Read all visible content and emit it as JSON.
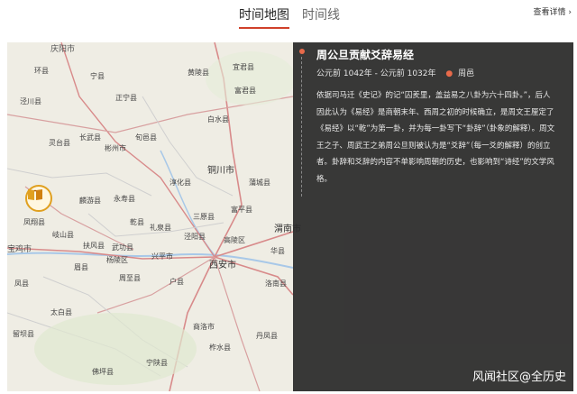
{
  "tabs": [
    {
      "label": "时间地图",
      "active": true
    },
    {
      "label": "时间线",
      "active": false
    }
  ],
  "detail_link": "查看详情 ›",
  "event": {
    "title": "周公旦贡献爻辞易经",
    "date_range": "公元前 1042年 - 公元前 1032年",
    "location": "周邑",
    "description": "依据司马迁《史记》的记“囚羑里，盖益易之八卦为六十四卦。”，后人因此认为《易经》是商朝末年、西周之初的时候确立，是周文王厘定了《易经》以“乾”为第一卦，并为每一卦写下“卦辞”（卦象的解释）。周文王之子、周武王之弟周公旦则被认为是“爻辞”（每一爻的解释）的创立者。卦辞和爻辞的内容不单影响周朝的历史，也影响到“诗经”的文学风格。"
  },
  "watermark": "风闻社区@全历史",
  "map_labels": {
    "l0": "庆阳市",
    "l1": "环县",
    "l2": "宁县",
    "l3": "正宁县",
    "l4": "泾川县",
    "l5": "宜君县",
    "l6": "富君县",
    "l7": "黄陵县",
    "l8": "旬邑县",
    "l9": "彬州市",
    "l10": "灵台县",
    "l11": "长武县",
    "l12": "铜川市",
    "l13": "淳化县",
    "l14": "永寿县",
    "l15": "麟游县",
    "l16": "乾县",
    "l17": "礼泉县",
    "l18": "凤翔县",
    "l19": "岐山县",
    "l20": "扶风县",
    "l21": "眉县",
    "l22": "杨陵区",
    "l23": "周至县",
    "l24": "兴平市",
    "l25": "西安市",
    "l26": "渭南市",
    "l27": "宝鸡市",
    "l28": "太白县",
    "l29": "商洛市",
    "l30": "柞水县",
    "l31": "佛坪县",
    "l32": "宁陕县",
    "l33": "白水县",
    "l34": "洛南县",
    "l35": "华县",
    "l36": "丹凤县",
    "l37": "蒲城县",
    "l38": "三原县",
    "l39": "高陵区",
    "l40": "富平县",
    "l41": "泾阳县",
    "l42": "武功县",
    "l43": "户县",
    "l44": "凤县",
    "l45": "留坝县"
  },
  "icons": {
    "marker": "book-icon",
    "location": "location-pin-icon"
  }
}
